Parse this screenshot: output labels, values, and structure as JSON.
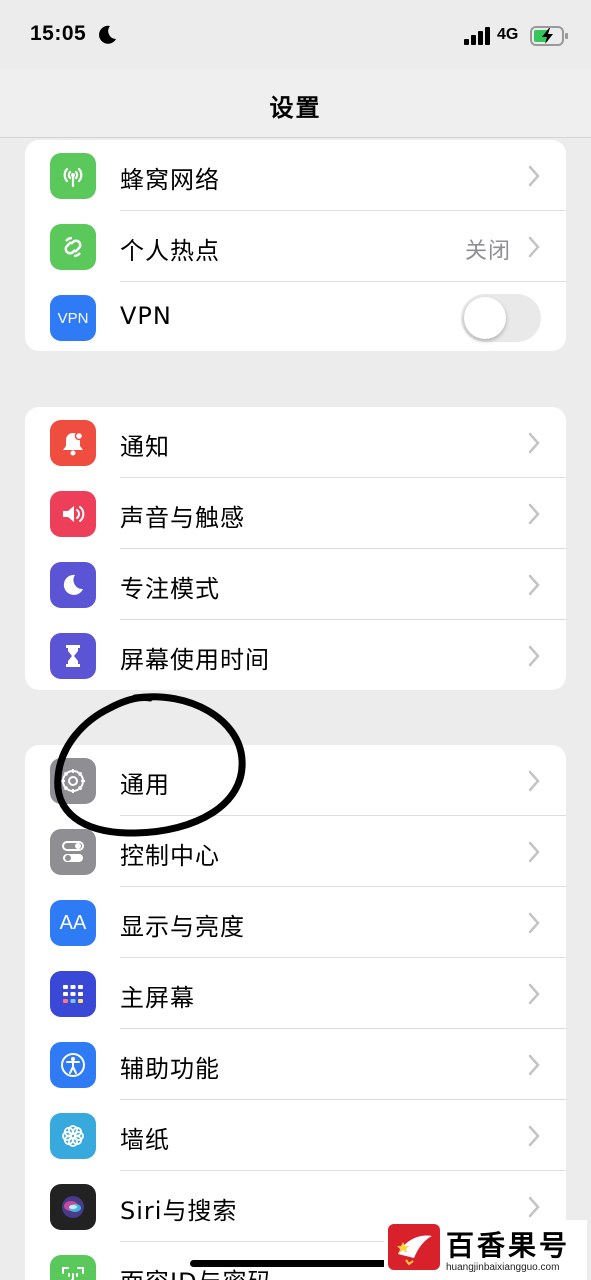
{
  "status_bar": {
    "time": "15:05",
    "network": "4G",
    "icons": [
      "moon-icon",
      "signal-icon",
      "battery-charging-icon"
    ]
  },
  "nav": {
    "title": "设置"
  },
  "groups": [
    {
      "rows": [
        {
          "label": "蜂窝网络",
          "icon": "cellular-antenna-icon",
          "color": "#5ac85a"
        },
        {
          "label": "个人热点",
          "icon": "hotspot-link-icon",
          "color": "#5ac85a",
          "value": "关闭"
        },
        {
          "label": "VPN",
          "icon": "vpn-icon",
          "color": "#2f7bf5",
          "toggle_on": false
        }
      ]
    },
    {
      "rows": [
        {
          "label": "通知",
          "icon": "bell-icon",
          "color": "#ee4d3f"
        },
        {
          "label": "声音与触感",
          "icon": "speaker-icon",
          "color": "#ee3f5a"
        },
        {
          "label": "专注模式",
          "icon": "moon-icon",
          "color": "#5b55d6"
        },
        {
          "label": "屏幕使用时间",
          "icon": "hourglass-icon",
          "color": "#5b55d6"
        }
      ]
    },
    {
      "rows": [
        {
          "label": "通用",
          "icon": "gear-icon",
          "color": "#8e8e93"
        },
        {
          "label": "控制中心",
          "icon": "toggles-icon",
          "color": "#8e8e93"
        },
        {
          "label": "显示与亮度",
          "icon": "text-size-icon",
          "color": "#2f7bf5"
        },
        {
          "label": "主屏幕",
          "icon": "app-grid-icon",
          "color": "#3a48d8"
        },
        {
          "label": "辅助功能",
          "icon": "accessibility-icon",
          "color": "#2f7bf5"
        },
        {
          "label": "墙纸",
          "icon": "flower-icon",
          "color": "#38a9dc"
        },
        {
          "label": "Siri与搜索",
          "icon": "siri-icon",
          "color": "#222222"
        },
        {
          "label": "面容ID与密码",
          "icon": "face-id-icon",
          "color": "#5ac85a"
        }
      ]
    }
  ],
  "vpn_icon_text": "VPN",
  "display_icon_text": "AA",
  "watermark": {
    "title": "百香果号",
    "url": "huangjinbaixiangguo.com"
  }
}
